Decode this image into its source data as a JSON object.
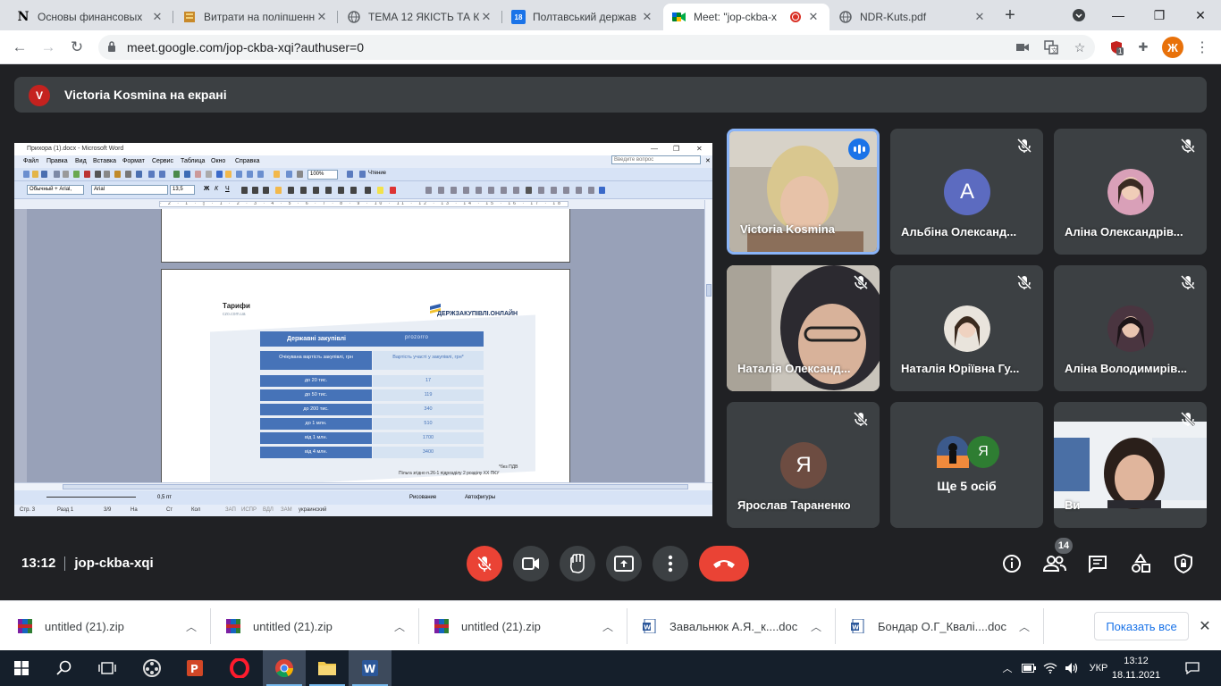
{
  "browser": {
    "tabs": [
      {
        "title": "Основы финансовых",
        "favicon": "notion-icon"
      },
      {
        "title": "Витрати на поліпшенн",
        "favicon": "archive-icon"
      },
      {
        "title": "ТЕМА 12 ЯКІСТЬ ТА К",
        "favicon": "globe-icon"
      },
      {
        "title": "Полтавський держав",
        "favicon": "calendar-icon"
      },
      {
        "title": "Meet: \"jop-ckba-x",
        "favicon": "meet-icon"
      },
      {
        "title": "NDR-Kuts.pdf",
        "favicon": "globe-icon"
      }
    ],
    "url": "meet.google.com/jop-ckba-xqi?authuser=0",
    "profile_initial": "Ж",
    "extension_badge": "1"
  },
  "meet": {
    "presenter": {
      "initial": "V",
      "text": "Victoria Kosmina на екрані"
    },
    "participants": [
      {
        "name": "Victoria Kosmina",
        "speaking": true
      },
      {
        "name": "Альбіна Олександ...",
        "initial": "A"
      },
      {
        "name": "Аліна Олександрів..."
      },
      {
        "name": "Наталія Олександ..."
      },
      {
        "name": "Наталія Юріївна Гу..."
      },
      {
        "name": "Аліна Володимирів..."
      },
      {
        "name": "Ярослав Тараненко",
        "initial": "Я"
      },
      {
        "name": "Ще 5 осіб",
        "initial": "Я"
      },
      {
        "name": "Ви"
      }
    ],
    "time": "13:12",
    "meeting_code": "jop-ckba-xqi",
    "people_count": "14"
  },
  "word": {
    "title": "Прихора (1).docx - Microsoft Word",
    "menu": [
      "Файл",
      "Правка",
      "Вид",
      "Вставка",
      "Формат",
      "Сервис",
      "Таблица",
      "Окно",
      "Справка"
    ],
    "help_placeholder": "Введите вопрос",
    "style": "Обычный + Arial,",
    "font": "Arial",
    "size": "13,5",
    "zoom": "100%",
    "reading": "Чтение",
    "draw_label": "Рисование",
    "autoshapes": "Автофигуры",
    "line_width": "0,5 пт",
    "status": {
      "page": "Стр. 3",
      "section": "Разд 1",
      "pages": "3/9",
      "at": "На",
      "ln": "Ст",
      "col": "Кол",
      "rec": "ЗАП",
      "trk": "ИСПР",
      "ext": "ВДЛ",
      "ovr": "ЗАМ",
      "lang": "украинский"
    },
    "slide": {
      "title": "Тарифи",
      "subtitle": "czo.com.ua",
      "brand": "ДЕРЖЗАКУПІВЛІ.ОНЛАЙН",
      "table_title": "Державні закупівлі",
      "table_brand": "prozorro",
      "col1": "Очікувана вартість закупівлі, грн",
      "col2": "Вартість участі у закупівлі, грн*",
      "rows": [
        {
          "range": "до 20 тис.",
          "price": "17"
        },
        {
          "range": "до 50 тис.",
          "price": "119"
        },
        {
          "range": "до 200 тис.",
          "price": "340"
        },
        {
          "range": "до 1 млн.",
          "price": "510"
        },
        {
          "range": "від 1 млн.",
          "price": "1700"
        },
        {
          "range": "від 4 млн.",
          "price": "3400"
        }
      ],
      "note1": "*без ПДВ",
      "note2": "Пільга згідно п.26-1 підрозділу 2 розділу XX ПКУ"
    }
  },
  "downloads": {
    "items": [
      {
        "name": "untitled (21).zip",
        "type": "zip"
      },
      {
        "name": "untitled (21).zip",
        "type": "zip"
      },
      {
        "name": "untitled (21).zip",
        "type": "zip"
      },
      {
        "name": "Завальнюк А.Я._к....doc",
        "type": "doc"
      },
      {
        "name": "Бондар О.Г_Квалі....doc",
        "type": "doc"
      }
    ],
    "show_all": "Показать все"
  },
  "taskbar": {
    "lang": "УКР",
    "time": "13:12",
    "date": "18.11.2021"
  }
}
